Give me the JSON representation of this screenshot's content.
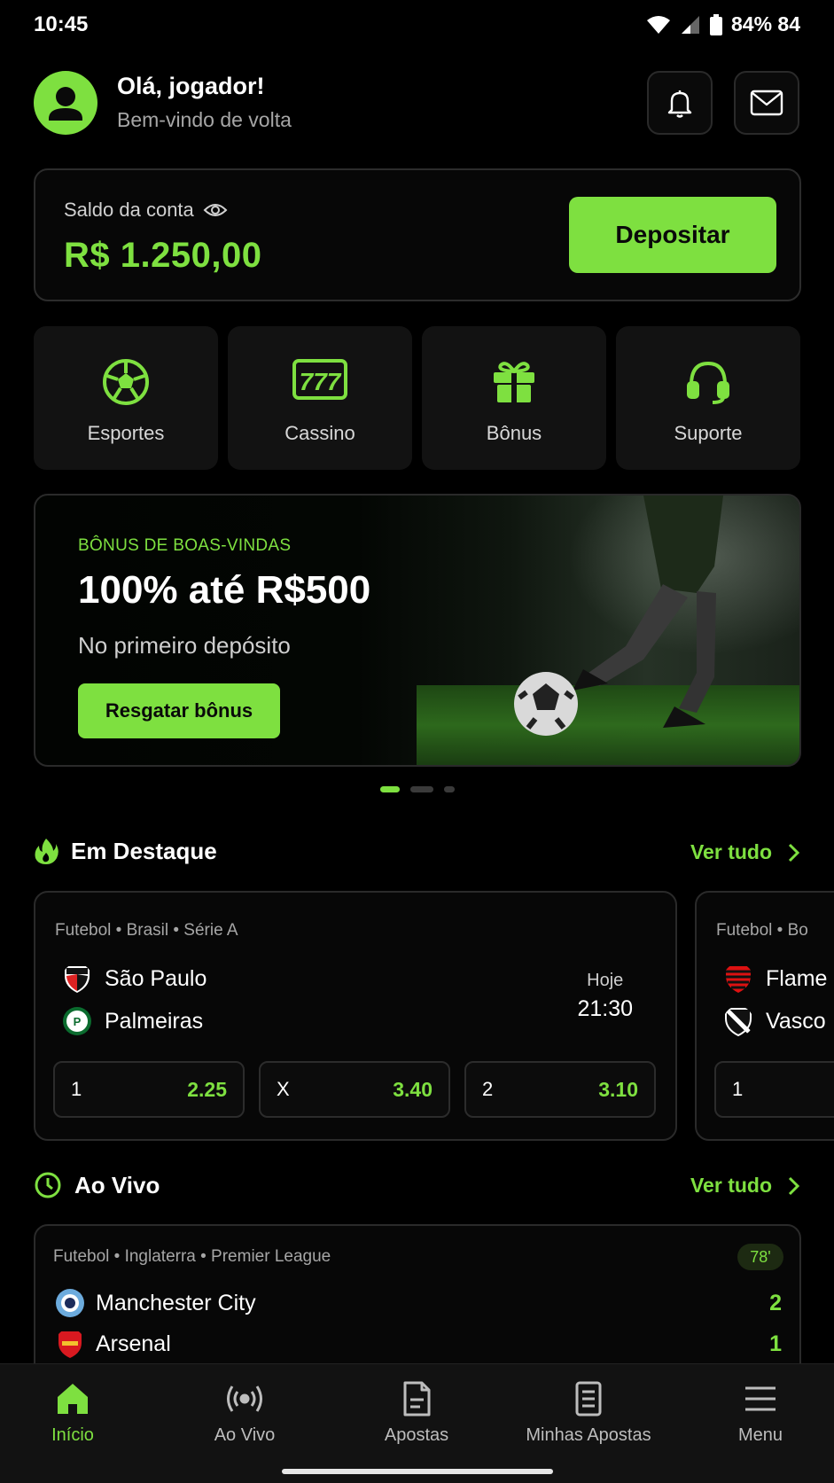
{
  "status_bar": {
    "time": "10:45",
    "battery_text": "84% 84"
  },
  "header": {
    "greeting": "Olá, jogador!",
    "subtitle": "Bem-vindo de volta"
  },
  "balance": {
    "label": "Saldo da conta",
    "amount": "R$ 1.250,00",
    "deposit_label": "Depositar"
  },
  "quick_actions": [
    {
      "label": "Esportes",
      "icon": "soccer-ball-icon"
    },
    {
      "label": "Cassino",
      "icon": "slot-777-icon"
    },
    {
      "label": "Bônus",
      "icon": "gift-icon"
    },
    {
      "label": "Suporte",
      "icon": "headset-icon"
    }
  ],
  "promo": {
    "eyebrow": "BÔNUS DE BOAS-VINDAS",
    "title": "100% até R$500",
    "description": "No primeiro depósito",
    "cta": "Resgatar bônus"
  },
  "featured": {
    "title": "Em Destaque",
    "see_all": "Ver tudo",
    "matches": [
      {
        "league": "Futebol • Brasil • Série A",
        "home": "São Paulo",
        "away": "Palmeiras",
        "day": "Hoje",
        "time": "21:30",
        "odds": [
          {
            "label": "1",
            "value": "2.25"
          },
          {
            "label": "X",
            "value": "3.40"
          },
          {
            "label": "2",
            "value": "3.10"
          }
        ]
      },
      {
        "league": "Futebol • Bo",
        "home": "Flame",
        "away": "Vasco",
        "odds": [
          {
            "label": "1",
            "value": ""
          }
        ]
      }
    ]
  },
  "live": {
    "title": "Ao Vivo",
    "see_all": "Ver tudo",
    "match": {
      "league": "Futebol • Inglaterra • Premier League",
      "minute": "78'",
      "home": "Manchester City",
      "home_score": "2",
      "away": "Arsenal",
      "away_score": "1"
    }
  },
  "bottom_nav": [
    {
      "label": "Início",
      "icon": "home-icon",
      "active": true
    },
    {
      "label": "Ao Vivo",
      "icon": "broadcast-icon",
      "active": false
    },
    {
      "label": "Apostas",
      "icon": "betslip-icon",
      "active": false
    },
    {
      "label": "Minhas Apostas",
      "icon": "receipt-icon",
      "active": false
    },
    {
      "label": "Menu",
      "icon": "hamburger-icon",
      "active": false
    }
  ],
  "colors": {
    "accent": "#7ee040",
    "background": "#000000",
    "card": "#121212"
  }
}
